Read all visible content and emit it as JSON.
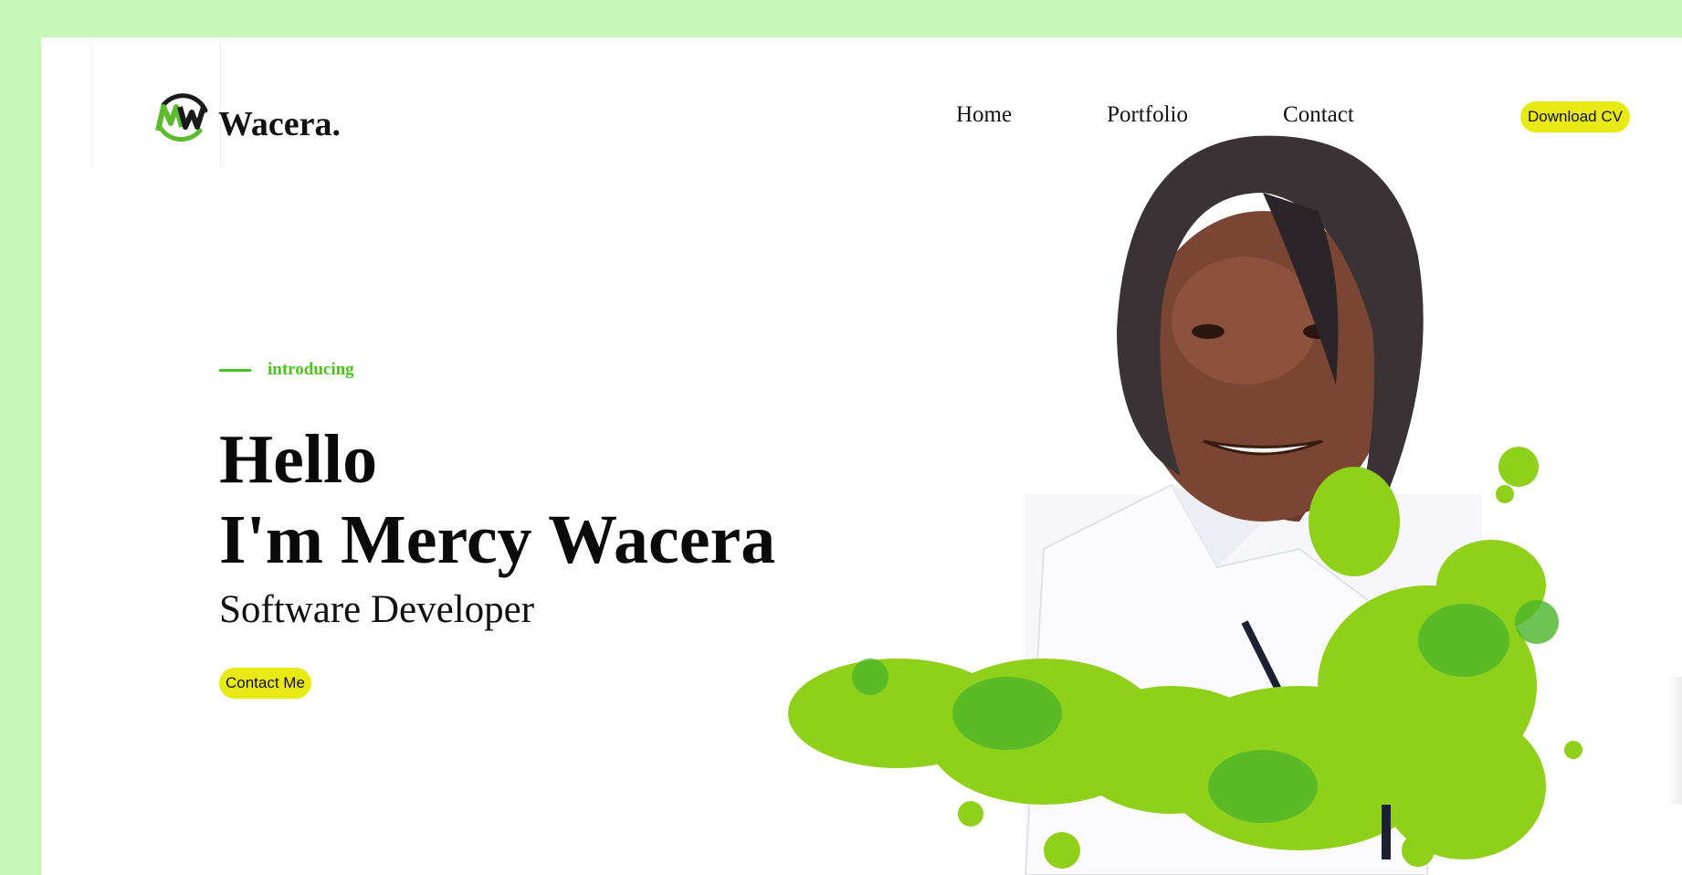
{
  "brand": {
    "name": "Wacera.",
    "logo_icon": "mw-logo-icon"
  },
  "nav": {
    "items": [
      {
        "label": "Home"
      },
      {
        "label": "Portfolio"
      },
      {
        "label": "Contact"
      }
    ],
    "cv_label": "Download CV"
  },
  "hero": {
    "intro": "introducing",
    "greeting_line1": "Hello",
    "greeting_line2": "I'm Mercy Wacera",
    "role": "Software Developer",
    "cta_label": "Contact Me",
    "image_icon": "portrait-photo"
  },
  "colors": {
    "page_bg": "#c7f7b6",
    "accent_green": "#4cc11f",
    "button_yellow": "#e9ea14",
    "text": "#0a0a0a"
  }
}
